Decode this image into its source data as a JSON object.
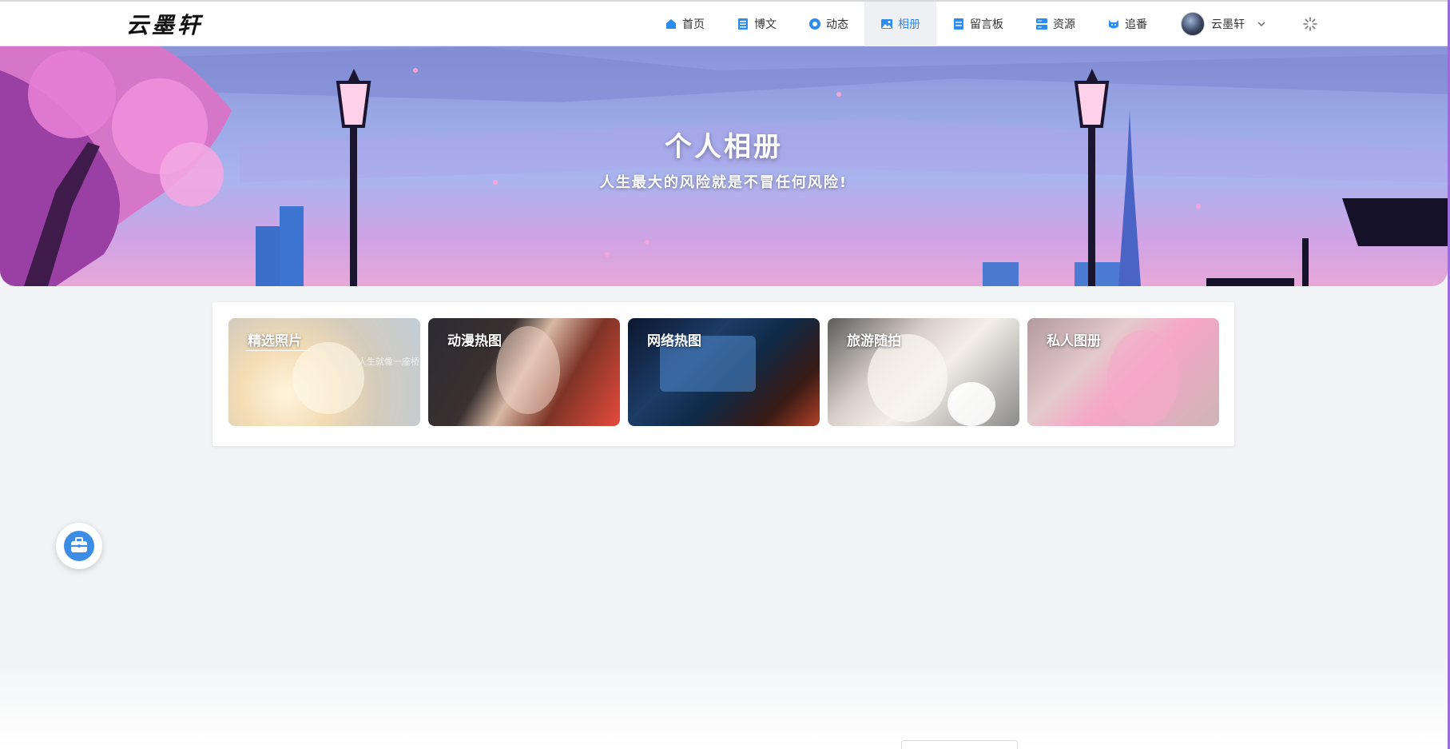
{
  "header": {
    "logo": "云墨轩",
    "nav": [
      {
        "label": "首页",
        "icon": "home-icon"
      },
      {
        "label": "博文",
        "icon": "list-icon"
      },
      {
        "label": "动态",
        "icon": "aperture-icon"
      },
      {
        "label": "相册",
        "icon": "image-icon",
        "active": true
      },
      {
        "label": "留言板",
        "icon": "note-icon"
      },
      {
        "label": "资源",
        "icon": "server-icon"
      },
      {
        "label": "追番",
        "icon": "cat-icon"
      }
    ],
    "user_name": "云墨轩"
  },
  "banner": {
    "title": "个人相册",
    "subtitle": "人生最大的风险就是不冒任何风险!"
  },
  "albums": [
    {
      "label": "精选照片",
      "hint": "人生就像一座桥"
    },
    {
      "label": "动漫热图"
    },
    {
      "label": "网络热图"
    },
    {
      "label": "旅游随拍"
    },
    {
      "label": "私人图册"
    }
  ],
  "colors": {
    "accent": "#2d8cf0",
    "nav_active_bg": "#eef0f3",
    "page_bg": "#f2f3f5"
  }
}
